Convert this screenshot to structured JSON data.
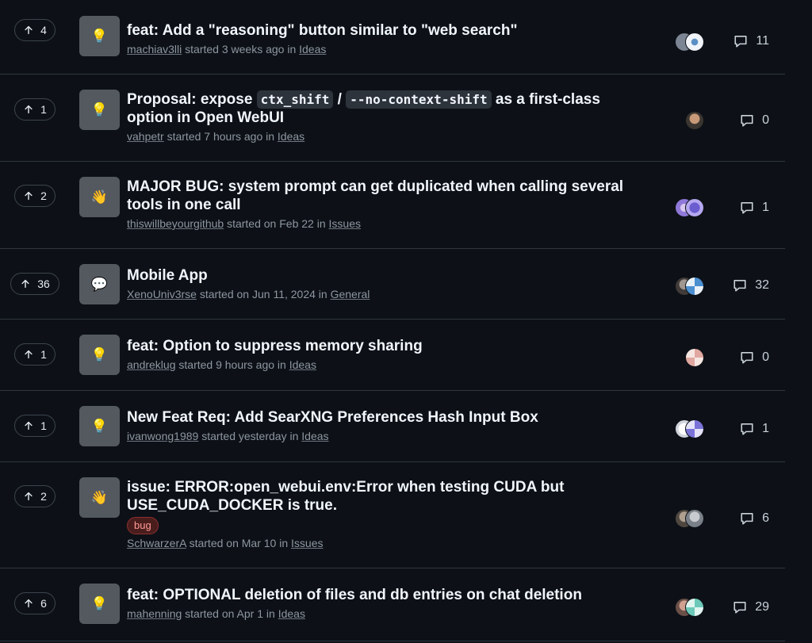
{
  "discussions": [
    {
      "votes": "4",
      "category_icon": "lightbulb-icon",
      "title": "feat: Add a \"reasoning\" button similar to \"web search\"",
      "author": "machiav3lli",
      "started": "started 3 weeks ago",
      "in": "in",
      "category": "Ideas",
      "comments": "11"
    },
    {
      "votes": "1",
      "category_icon": "lightbulb-icon",
      "title_parts": [
        "Proposal: expose ",
        "ctx_shift",
        " / ",
        "--no-context-shift",
        " as a first-class option in Open WebUI"
      ],
      "author": "vahpetr",
      "started": "started 7 hours ago",
      "in": "in",
      "category": "Ideas",
      "comments": "0"
    },
    {
      "votes": "2",
      "category_icon": "waving-hand-icon",
      "title": "MAJOR BUG: system prompt can get duplicated when calling several tools in one call",
      "author": "thiswillbeyourgithub",
      "started": "started on Feb 22",
      "in": "in",
      "category": "Issues",
      "comments": "1"
    },
    {
      "votes": "36",
      "category_icon": "speech-bubble-icon",
      "title": "Mobile App",
      "author": "XenoUniv3rse",
      "started": "started on Jun 11, 2024",
      "in": "in",
      "category": "General",
      "comments": "32"
    },
    {
      "votes": "1",
      "category_icon": "lightbulb-icon",
      "title": "feat: Option to suppress memory sharing",
      "author": "andreklug",
      "started": "started 9 hours ago",
      "in": "in",
      "category": "Ideas",
      "comments": "0"
    },
    {
      "votes": "1",
      "category_icon": "lightbulb-icon",
      "title": "New Feat Req: Add SearXNG Preferences Hash Input Box",
      "author": "ivanwong1989",
      "started": "started yesterday",
      "in": "in",
      "category": "Ideas",
      "comments": "1"
    },
    {
      "votes": "2",
      "category_icon": "waving-hand-icon",
      "title": "issue: ERROR:open_webui.env:Error when testing CUDA but USE_CUDA_DOCKER is true.",
      "label": "bug",
      "author": "SchwarzerA",
      "started": "started on Mar 10",
      "in": "in",
      "category": "Issues",
      "comments": "6"
    },
    {
      "votes": "6",
      "category_icon": "lightbulb-icon",
      "title": "feat: OPTIONAL deletion of files and db entries on chat deletion",
      "author": "mahenning",
      "started": "started on Apr 1",
      "in": "in",
      "category": "Ideas",
      "comments": "29"
    }
  ],
  "colors": {
    "background": "#0d1117",
    "border": "#30363d",
    "category_tile": "#545960",
    "bug_label": "#ff9c97"
  }
}
